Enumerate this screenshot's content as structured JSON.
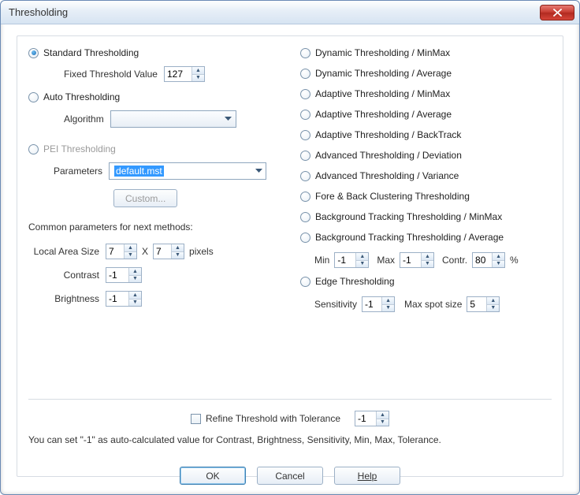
{
  "window": {
    "title": "Thresholding"
  },
  "left": {
    "standard": {
      "label": "Standard Thresholding",
      "checked": true
    },
    "fixed_label": "Fixed Threshold Value",
    "fixed_value": "127",
    "auto": {
      "label": "Auto Thresholding",
      "checked": false
    },
    "algorithm_label": "Algorithm",
    "algorithm_value": "",
    "pei": {
      "label": "PEI Thresholding",
      "checked": false,
      "disabled": true
    },
    "parameters_label": "Parameters",
    "parameters_value": "default.mst",
    "custom_btn": "Custom...",
    "common_header": "Common parameters for next methods:",
    "local_area_label": "Local Area Size",
    "local_area_w": "7",
    "x_label": "X",
    "local_area_h": "7",
    "pixels_label": "pixels",
    "contrast_label": "Contrast",
    "contrast_value": "-1",
    "brightness_label": "Brightness",
    "brightness_value": "-1"
  },
  "right": {
    "methods": [
      "Dynamic Thresholding / MinMax",
      "Dynamic Thresholding / Average",
      "Adaptive Thresholding / MinMax",
      "Adaptive Thresholding / Average",
      "Adaptive Thresholding / BackTrack",
      "Advanced Thresholding / Deviation",
      "Advanced Thresholding / Variance",
      "Fore & Back Clustering Thresholding",
      "Background Tracking Thresholding / MinMax",
      "Background Tracking Thresholding / Average"
    ],
    "min_label": "Min",
    "min_value": "-1",
    "max_label": "Max",
    "max_value": "-1",
    "contr_label": "Contr.",
    "contr_value": "80",
    "pct": "%",
    "edge": {
      "label": "Edge Thresholding"
    },
    "sensitivity_label": "Sensitivity",
    "sensitivity_value": "-1",
    "maxspot_label": "Max spot size",
    "maxspot_value": "5"
  },
  "bottom": {
    "refine_label": "Refine Threshold with Tolerance",
    "refine_value": "-1",
    "note": "You can set \"-1\" as auto-calculated value for Contrast, Brightness, Sensitivity, Min, Max, Tolerance."
  },
  "buttons": {
    "ok": "OK",
    "cancel": "Cancel",
    "help": "Help"
  }
}
